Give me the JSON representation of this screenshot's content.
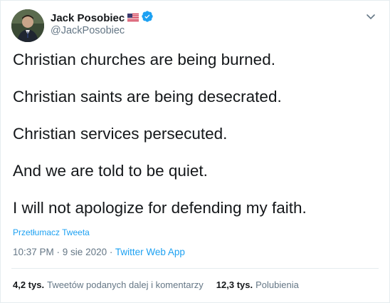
{
  "author": {
    "name": "Jack Posobiec",
    "handle": "@JackPosobiec"
  },
  "tweet": {
    "lines": [
      "Christian churches are being burned.",
      "Christian saints are being desecrated.",
      "Christian services persecuted.",
      "And we are told to be quiet.",
      "I will not apologize for defending my faith."
    ],
    "translate_label": "Przetłumacz Tweeta"
  },
  "meta": {
    "time": "10:37 PM",
    "separator1": " · ",
    "date": "9 sie 2020",
    "separator2": " · ",
    "app": "Twitter Web App"
  },
  "stats": {
    "retweets_count": "4,2 tys.",
    "retweets_label": "Tweetów podanych dalej i komentarzy",
    "likes_count": "12,3 tys.",
    "likes_label": "Polubienia"
  },
  "colors": {
    "accent": "#1da1f2",
    "text": "#14171a",
    "secondary": "#657786",
    "border": "#e6ecf0"
  },
  "icons": [
    "us-flag-icon",
    "verified-badge-icon",
    "chevron-down-icon"
  ]
}
